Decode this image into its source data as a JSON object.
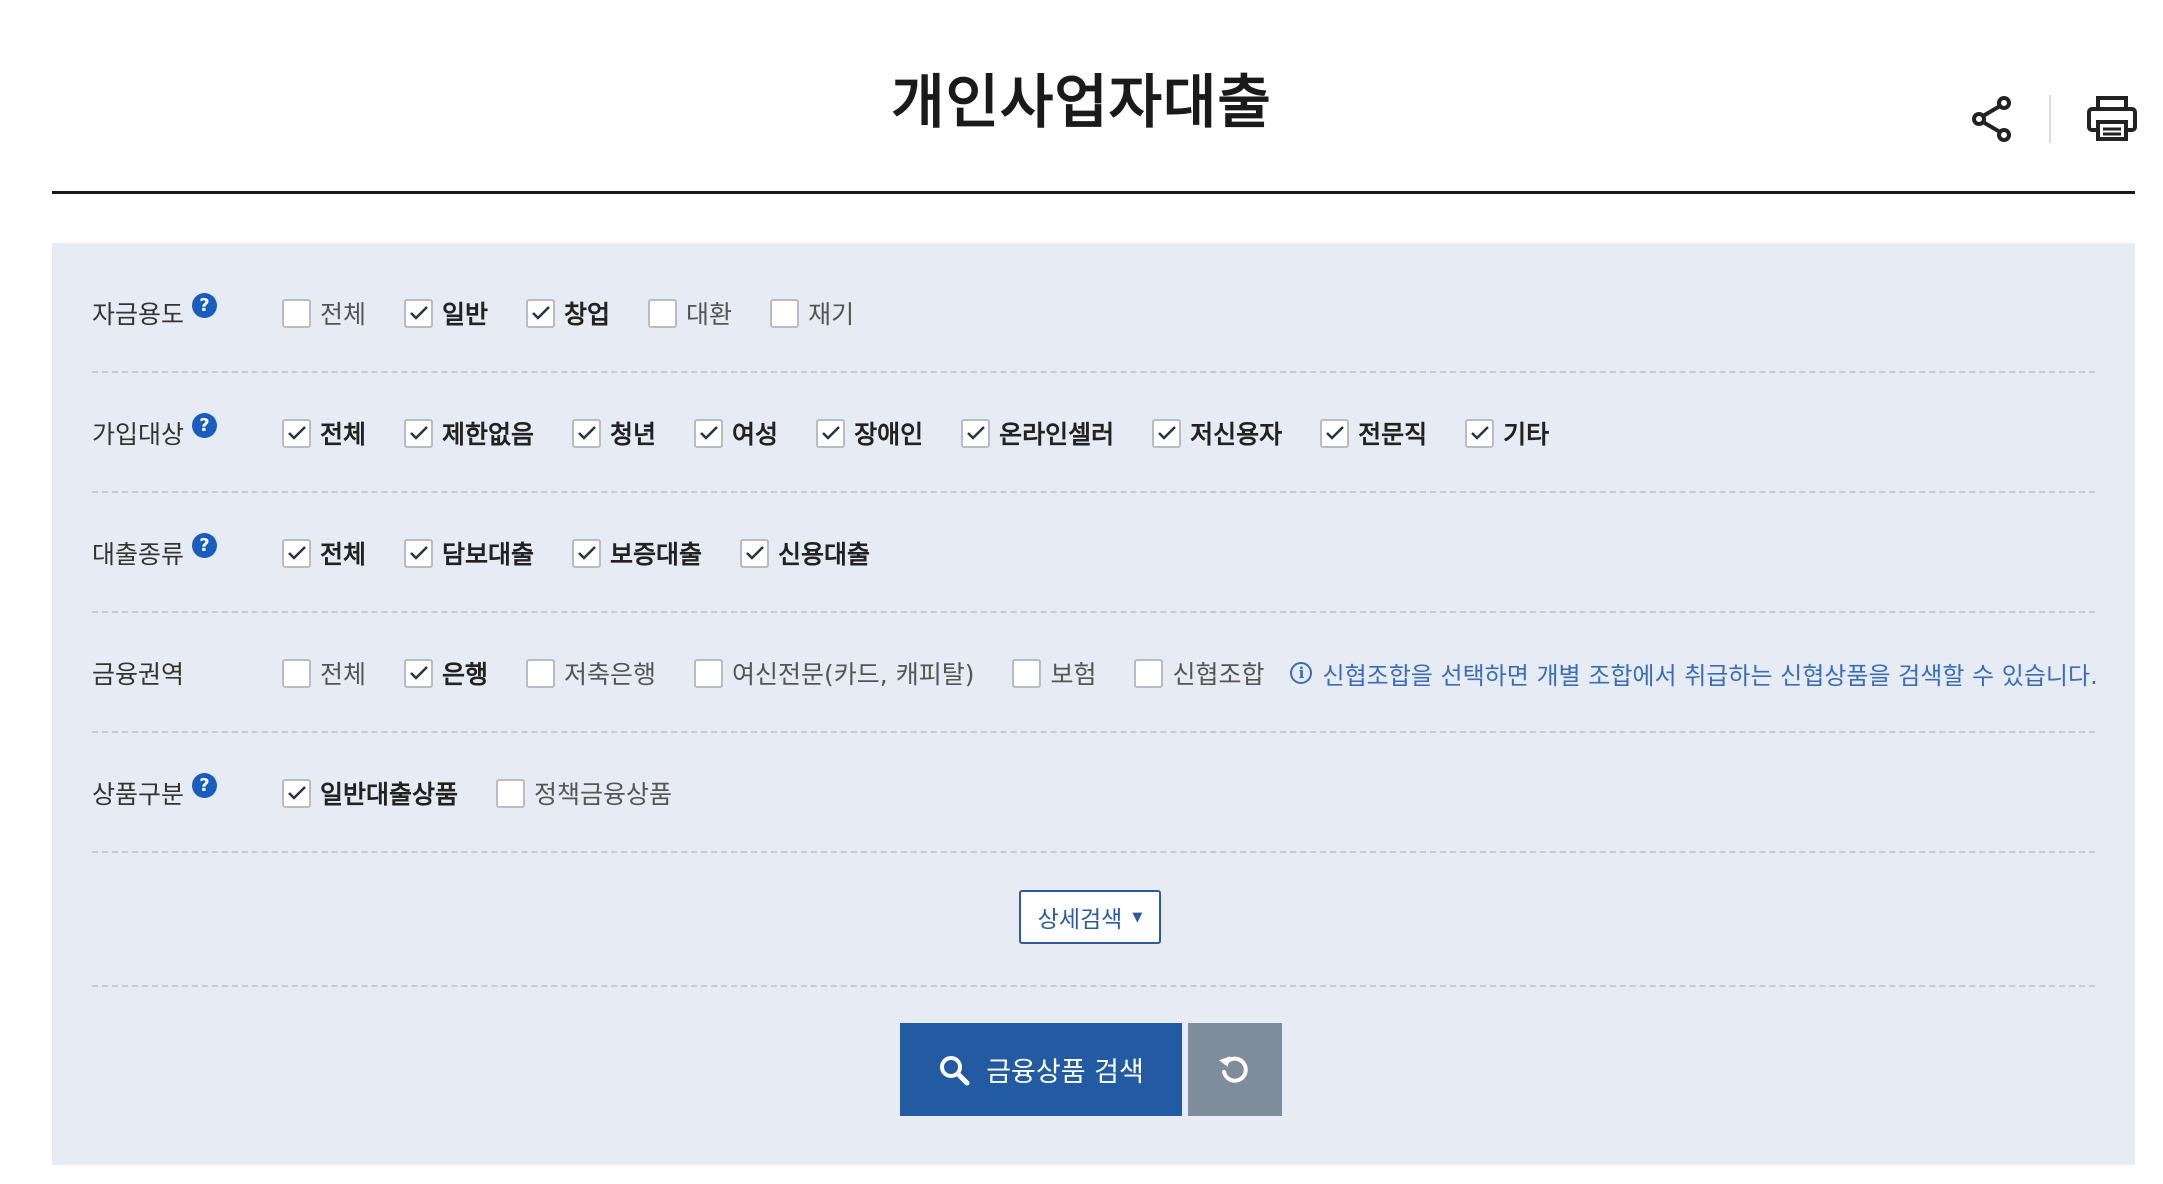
{
  "page": {
    "title": "개인사업자대출",
    "share_icon": "share-icon",
    "print_icon": "print-icon"
  },
  "filters": [
    {
      "label": "자금용도",
      "help": true,
      "options": [
        {
          "label": "전체",
          "checked": false
        },
        {
          "label": "일반",
          "checked": true
        },
        {
          "label": "창업",
          "checked": true
        },
        {
          "label": "대환",
          "checked": false
        },
        {
          "label": "재기",
          "checked": false
        }
      ]
    },
    {
      "label": "가입대상",
      "help": true,
      "options": [
        {
          "label": "전체",
          "checked": true
        },
        {
          "label": "제한없음",
          "checked": true
        },
        {
          "label": "청년",
          "checked": true
        },
        {
          "label": "여성",
          "checked": true
        },
        {
          "label": "장애인",
          "checked": true
        },
        {
          "label": "온라인셀러",
          "checked": true
        },
        {
          "label": "저신용자",
          "checked": true
        },
        {
          "label": "전문직",
          "checked": true
        },
        {
          "label": "기타",
          "checked": true
        }
      ]
    },
    {
      "label": "대출종류",
      "help": true,
      "options": [
        {
          "label": "전체",
          "checked": true
        },
        {
          "label": "담보대출",
          "checked": true
        },
        {
          "label": "보증대출",
          "checked": true
        },
        {
          "label": "신용대출",
          "checked": true
        }
      ]
    },
    {
      "label": "금융권역",
      "help": false,
      "options": [
        {
          "label": "전체",
          "checked": false
        },
        {
          "label": "은행",
          "checked": true
        },
        {
          "label": "저축은행",
          "checked": false
        },
        {
          "label": "여신전문(카드, 캐피탈)",
          "checked": false
        },
        {
          "label": "보험",
          "checked": false
        },
        {
          "label": "신협조합",
          "checked": false
        }
      ],
      "notice": "신협조합을 선택하면 개별 조합에서 취급하는 신협상품을 검색할 수 있습니다."
    },
    {
      "label": "상품구분",
      "help": true,
      "options": [
        {
          "label": "일반대출상품",
          "checked": true
        },
        {
          "label": "정책금융상품",
          "checked": false
        }
      ]
    }
  ],
  "detail_search": {
    "label": "상세검색"
  },
  "actions": {
    "search_label": "금융상품 검색",
    "reset_icon": "reset-icon"
  },
  "colors": {
    "primary": "#235ba3",
    "help": "#1b5cbf",
    "panel": "#e7ecf4",
    "reset": "#7f8c9c",
    "notice": "#3a6db8"
  }
}
